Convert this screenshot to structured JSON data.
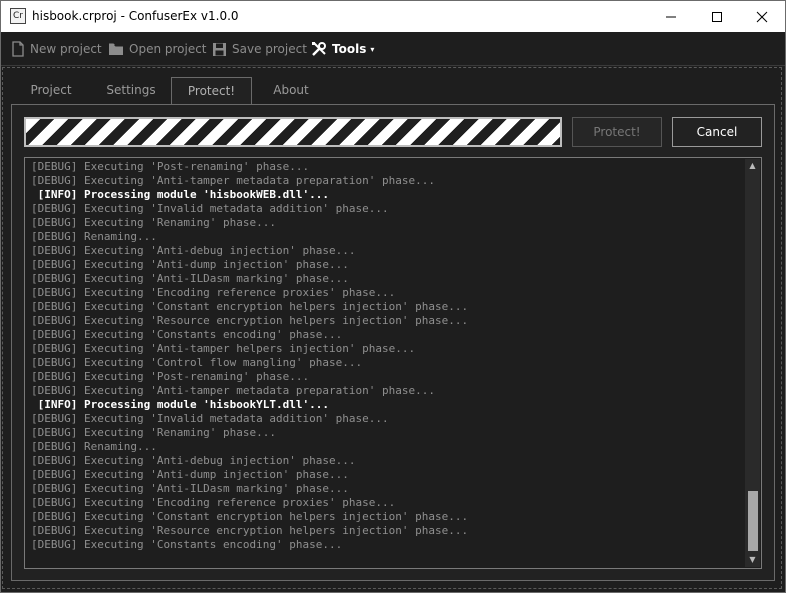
{
  "window": {
    "title": "hisbook.crproj - ConfuserEx v1.0.0",
    "icon_text": "Cr"
  },
  "toolbar": {
    "new_label": "New project",
    "open_label": "Open project",
    "save_label": "Save project",
    "tools_label": "Tools",
    "tools_caret": "▾"
  },
  "tabs": {
    "project": "Project",
    "settings": "Settings",
    "protect": "Protect!",
    "about": "About",
    "selected": "Protect!"
  },
  "progress": {
    "state": "indeterminate"
  },
  "actions": {
    "protect_label": "Protect!",
    "cancel_label": "Cancel"
  },
  "log": {
    "lines": [
      {
        "text": "[DEBUG] Executing 'Post-renaming' phase...",
        "level": "debug"
      },
      {
        "text": "[DEBUG] Executing 'Anti-tamper metadata preparation' phase...",
        "level": "debug"
      },
      {
        "text": " [INFO] Processing module 'hisbookWEB.dll'...",
        "level": "info"
      },
      {
        "text": "[DEBUG] Executing 'Invalid metadata addition' phase...",
        "level": "debug"
      },
      {
        "text": "[DEBUG] Executing 'Renaming' phase...",
        "level": "debug"
      },
      {
        "text": "[DEBUG] Renaming...",
        "level": "debug"
      },
      {
        "text": "[DEBUG] Executing 'Anti-debug injection' phase...",
        "level": "debug"
      },
      {
        "text": "[DEBUG] Executing 'Anti-dump injection' phase...",
        "level": "debug"
      },
      {
        "text": "[DEBUG] Executing 'Anti-ILDasm marking' phase...",
        "level": "debug"
      },
      {
        "text": "[DEBUG] Executing 'Encoding reference proxies' phase...",
        "level": "debug"
      },
      {
        "text": "[DEBUG] Executing 'Constant encryption helpers injection' phase...",
        "level": "debug"
      },
      {
        "text": "[DEBUG] Executing 'Resource encryption helpers injection' phase...",
        "level": "debug"
      },
      {
        "text": "[DEBUG] Executing 'Constants encoding' phase...",
        "level": "debug"
      },
      {
        "text": "[DEBUG] Executing 'Anti-tamper helpers injection' phase...",
        "level": "debug"
      },
      {
        "text": "[DEBUG] Executing 'Control flow mangling' phase...",
        "level": "debug"
      },
      {
        "text": "[DEBUG] Executing 'Post-renaming' phase...",
        "level": "debug"
      },
      {
        "text": "[DEBUG] Executing 'Anti-tamper metadata preparation' phase...",
        "level": "debug"
      },
      {
        "text": " [INFO] Processing module 'hisbookYLT.dll'...",
        "level": "info"
      },
      {
        "text": "[DEBUG] Executing 'Invalid metadata addition' phase...",
        "level": "debug"
      },
      {
        "text": "[DEBUG] Executing 'Renaming' phase...",
        "level": "debug"
      },
      {
        "text": "[DEBUG] Renaming...",
        "level": "debug"
      },
      {
        "text": "[DEBUG] Executing 'Anti-debug injection' phase...",
        "level": "debug"
      },
      {
        "text": "[DEBUG] Executing 'Anti-dump injection' phase...",
        "level": "debug"
      },
      {
        "text": "[DEBUG] Executing 'Anti-ILDasm marking' phase...",
        "level": "debug"
      },
      {
        "text": "[DEBUG] Executing 'Encoding reference proxies' phase...",
        "level": "debug"
      },
      {
        "text": "[DEBUG] Executing 'Constant encryption helpers injection' phase...",
        "level": "debug"
      },
      {
        "text": "[DEBUG] Executing 'Resource encryption helpers injection' phase...",
        "level": "debug"
      },
      {
        "text": "[DEBUG] Executing 'Constants encoding' phase...",
        "level": "debug"
      }
    ]
  },
  "icons": {
    "new": "new-file-icon",
    "open": "folder-icon",
    "save": "floppy-disk-icon",
    "tools": "wrench-screwdriver-icon"
  },
  "colors": {
    "background": "#1e1e1e",
    "text": "#ffffff",
    "debug_text": "#8f8f8f",
    "disabled_text": "#8c8c8c"
  }
}
